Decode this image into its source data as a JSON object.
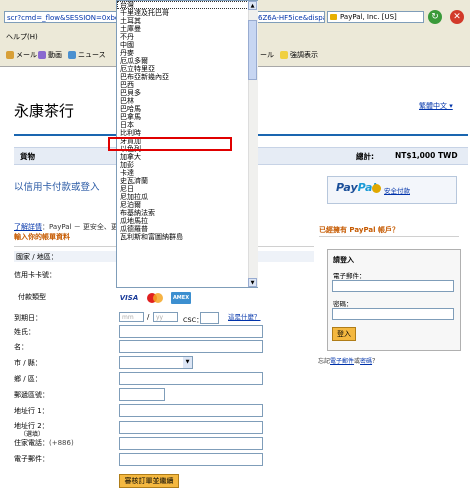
{
  "browser": {
    "address_left": "scr?cmd=_flow&SESSION=0xboXF5nhl...",
    "address_right": "F6Z6A-HF5ice&dispatch=50a222a67",
    "cert_label": "PayPal, Inc. [US]",
    "menu_help": "ヘルプ(H)",
    "toolbar": [
      "メール",
      "動画",
      "ニュース",
      "ール",
      "強調表示"
    ]
  },
  "page": {
    "store_name": "永康茶行",
    "language_link": "繁體中文",
    "bar": {
      "goods": "貨物",
      "total_label": "總計:",
      "total_value": "NT$1,000 TWD"
    },
    "heading": "以信用卡付款或登入",
    "paypal_logo_a": "Pay",
    "paypal_logo_b": "Pal",
    "secure_link": "安全付款",
    "learn_more_link": "了解詳情",
    "learn_more_text": "：PayPal － 更安全、更",
    "enter_info": "輸入你的帳單資料",
    "already_member": "已經擁有 PayPal 帳戶？",
    "login": {
      "title": "請登入",
      "email_label": "電子郵件：",
      "password_label": "密碼：",
      "button": "登入",
      "forgot_prefix": "忘記",
      "forgot_email": "電子郵件",
      "forgot_mid": "或",
      "forgot_pw": "密碼"
    }
  },
  "form": {
    "country_label": "國家 / 地區：",
    "card_number_label": "信用卡卡號：",
    "payment_type_label": "付款類型",
    "cards": {
      "visa": "VISA",
      "amex": "AMEX"
    },
    "expiry_label": "到期日：",
    "mm_placeholder": "mm",
    "yy_placeholder": "yy",
    "csc_label": "CSC：",
    "csc_help": "這是什麼？",
    "last_name_label": "姓氏：",
    "first_name_label": "名：",
    "city_label": "市 / 縣：",
    "district_label": "鄉 / 區：",
    "postal_label": "郵遞區號：",
    "address1_label": "地址行 1：",
    "address2_label": "地址行 2：",
    "address2_note": "（選填）",
    "phone_label": "住家電話：",
    "phone_prefix": "(+886)",
    "email_label": "電子郵件：",
    "submit": "審核訂單並繼續"
  },
  "dropdown_options": [
    "台灣",
    "千里達及托巴哥",
    "土耳其",
    "土庫曼",
    "不丹",
    "中國",
    "丹麥",
    "厄瓜多爾",
    "厄立特里亞",
    "巴布亞新幾內亞",
    "巴西",
    "巴貝多",
    "巴林",
    "巴哈馬",
    "巴拿馬",
    "日本",
    "比利時",
    "牙買加",
    "以色列",
    "加拿大",
    "加彭",
    "卡達",
    "史瓦濟蘭",
    "尼日",
    "尼加拉瓜",
    "尼泊爾",
    "布基納法索",
    "瓜地馬拉",
    "瓜德羅普",
    "瓦利斯和富圖納群島"
  ]
}
